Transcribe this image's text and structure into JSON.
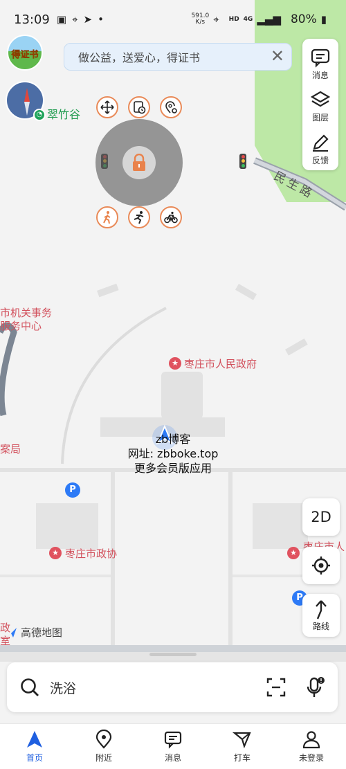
{
  "status_bar": {
    "time": "13:09",
    "net_speed_value": "591.0",
    "net_speed_unit": "K/s",
    "battery": "80%",
    "hd_label": "HD",
    "lte_label": "4G"
  },
  "app_logo_text": "得证书",
  "banner": {
    "text": "做公益，送爱心，得证书",
    "close": "✕"
  },
  "right_panel": [
    {
      "label": "消息",
      "icon": "message-icon"
    },
    {
      "label": "图层",
      "icon": "layers-icon"
    },
    {
      "label": "反馈",
      "icon": "feedback-icon"
    }
  ],
  "compass_place": "翠竹谷",
  "map": {
    "road_minsheng": "民生路",
    "poi_gov_service_line1": "市机关事务",
    "poi_gov_service_line2": "服务中心",
    "poi_peoples_gov": "枣庄市人民政府",
    "poi_cppcc": "枣庄市政协",
    "poi_partial_right": "枣庄市人",
    "poi_left_edge": "案局",
    "poi_left_bottom_1": "政",
    "poi_left_bottom_2": "室"
  },
  "watermark": {
    "line1": "zb博客",
    "line2": "网址: zbboke.top",
    "line3": "更多会员版应用"
  },
  "controls": {
    "mode_2d": "2D",
    "route_label": "路线"
  },
  "amap_brand": "高德地图",
  "search": {
    "value": "洗浴"
  },
  "bottom_nav": [
    {
      "label": "首页",
      "icon": "home-arrow-icon",
      "active": true
    },
    {
      "label": "附近",
      "icon": "nearby-pin-icon",
      "active": false
    },
    {
      "label": "消息",
      "icon": "message-icon",
      "active": false
    },
    {
      "label": "打车",
      "icon": "taxi-icon",
      "active": false
    },
    {
      "label": "未登录",
      "icon": "user-icon",
      "active": false
    }
  ],
  "colors": {
    "accent": "#1f5fe0",
    "poi": "#e0525f",
    "park": "#bde8a6",
    "tool_border": "#e98a58"
  }
}
